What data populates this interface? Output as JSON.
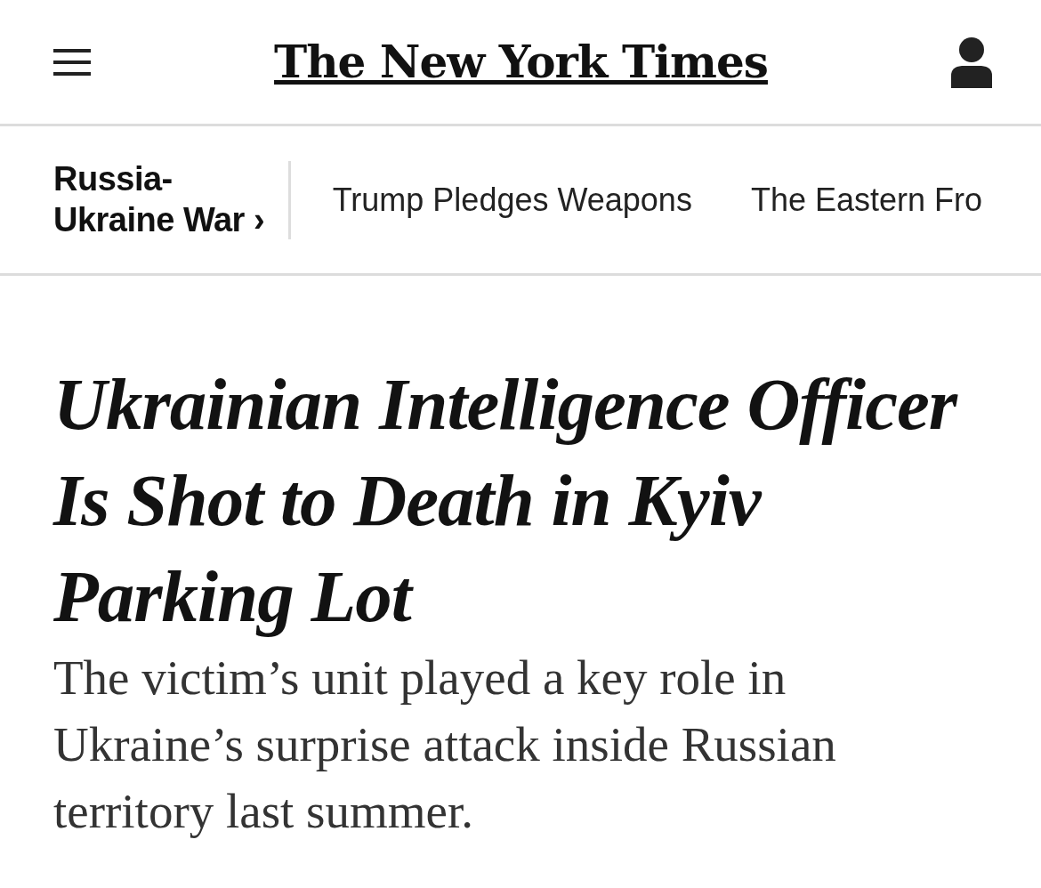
{
  "masthead": {
    "logo": "The New York Times"
  },
  "section_nav": {
    "section": "Russia-Ukraine War ›",
    "links": [
      "Trump Pledges Weapons",
      "The Eastern Fro"
    ]
  },
  "article": {
    "headline": "Ukrainian Intelligence Officer Is Shot to Death in Kyiv Parking Lot",
    "summary": "The victim’s unit played a key role in Ukraine’s surprise attack inside Russian territory last summer."
  }
}
